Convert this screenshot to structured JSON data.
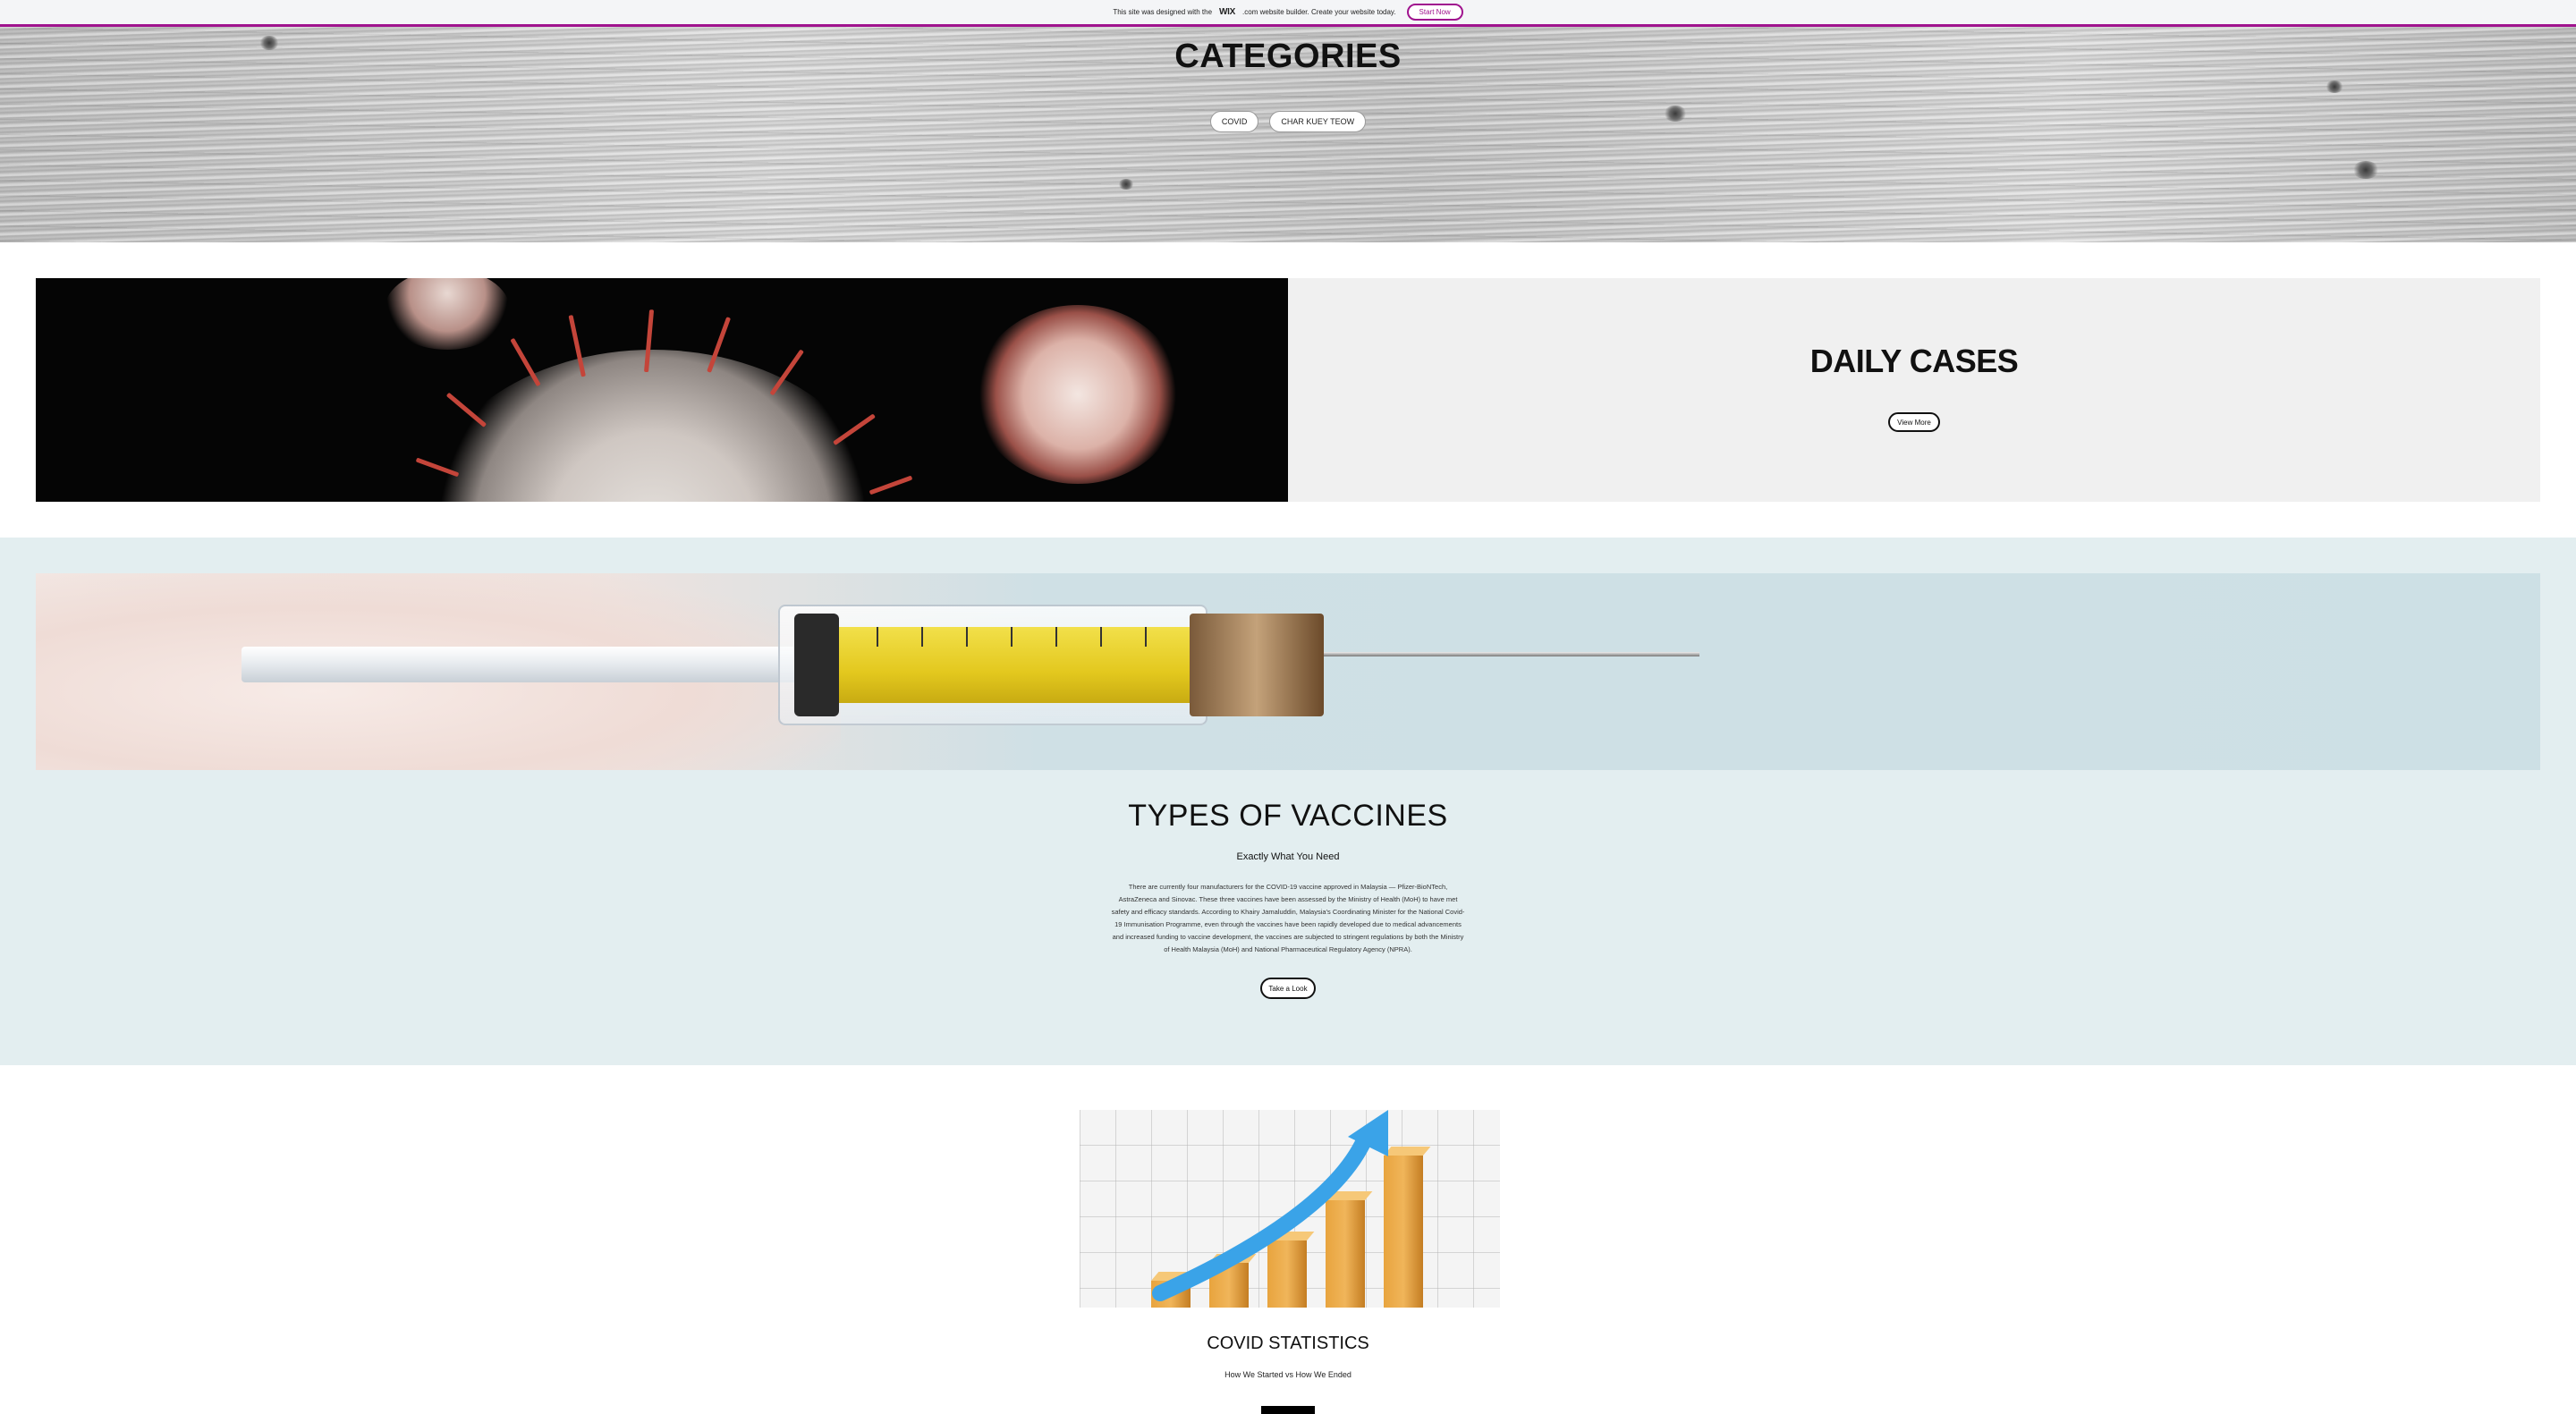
{
  "banner": {
    "text_before": "This site was designed with the",
    "brand": "WIX",
    "text_after": ".com website builder. Create your website today.",
    "cta": "Start Now",
    "accent": "#a0138e"
  },
  "categories": {
    "title": "CATEGORIES",
    "pills": [
      "COVID",
      "CHAR KUEY TEOW"
    ]
  },
  "daily_cases": {
    "title": "DAILY CASES",
    "button": "View More"
  },
  "vaccines": {
    "title": "TYPES OF VACCINES",
    "subtitle": "Exactly What You Need",
    "body": "There are currently four manufacturers for the COVID-19 vaccine approved in Malaysia — Pfizer-BioNTech, AstraZeneca and Sinovac. These three vaccines have been assessed by the Ministry of Health (MoH) to have met safety and efficacy standards. According to Khairy Jamaluddin, Malaysia's Coordinating Minister for the National Covid-19 Immunisation Programme, even through the vaccines have been rapidly developed due to medical advancements and increased funding to vaccine development, the vaccines are subjected to stringent regulations by both the Ministry of Health Malaysia (MoH) and National Pharmaceutical Regulatory Agency (NPRA).",
    "button": "Take a Look",
    "bg_color": "#e3eef0"
  },
  "statistics": {
    "title": "COVID STATISTICS",
    "subtitle": "How We Started vs How We Ended"
  }
}
